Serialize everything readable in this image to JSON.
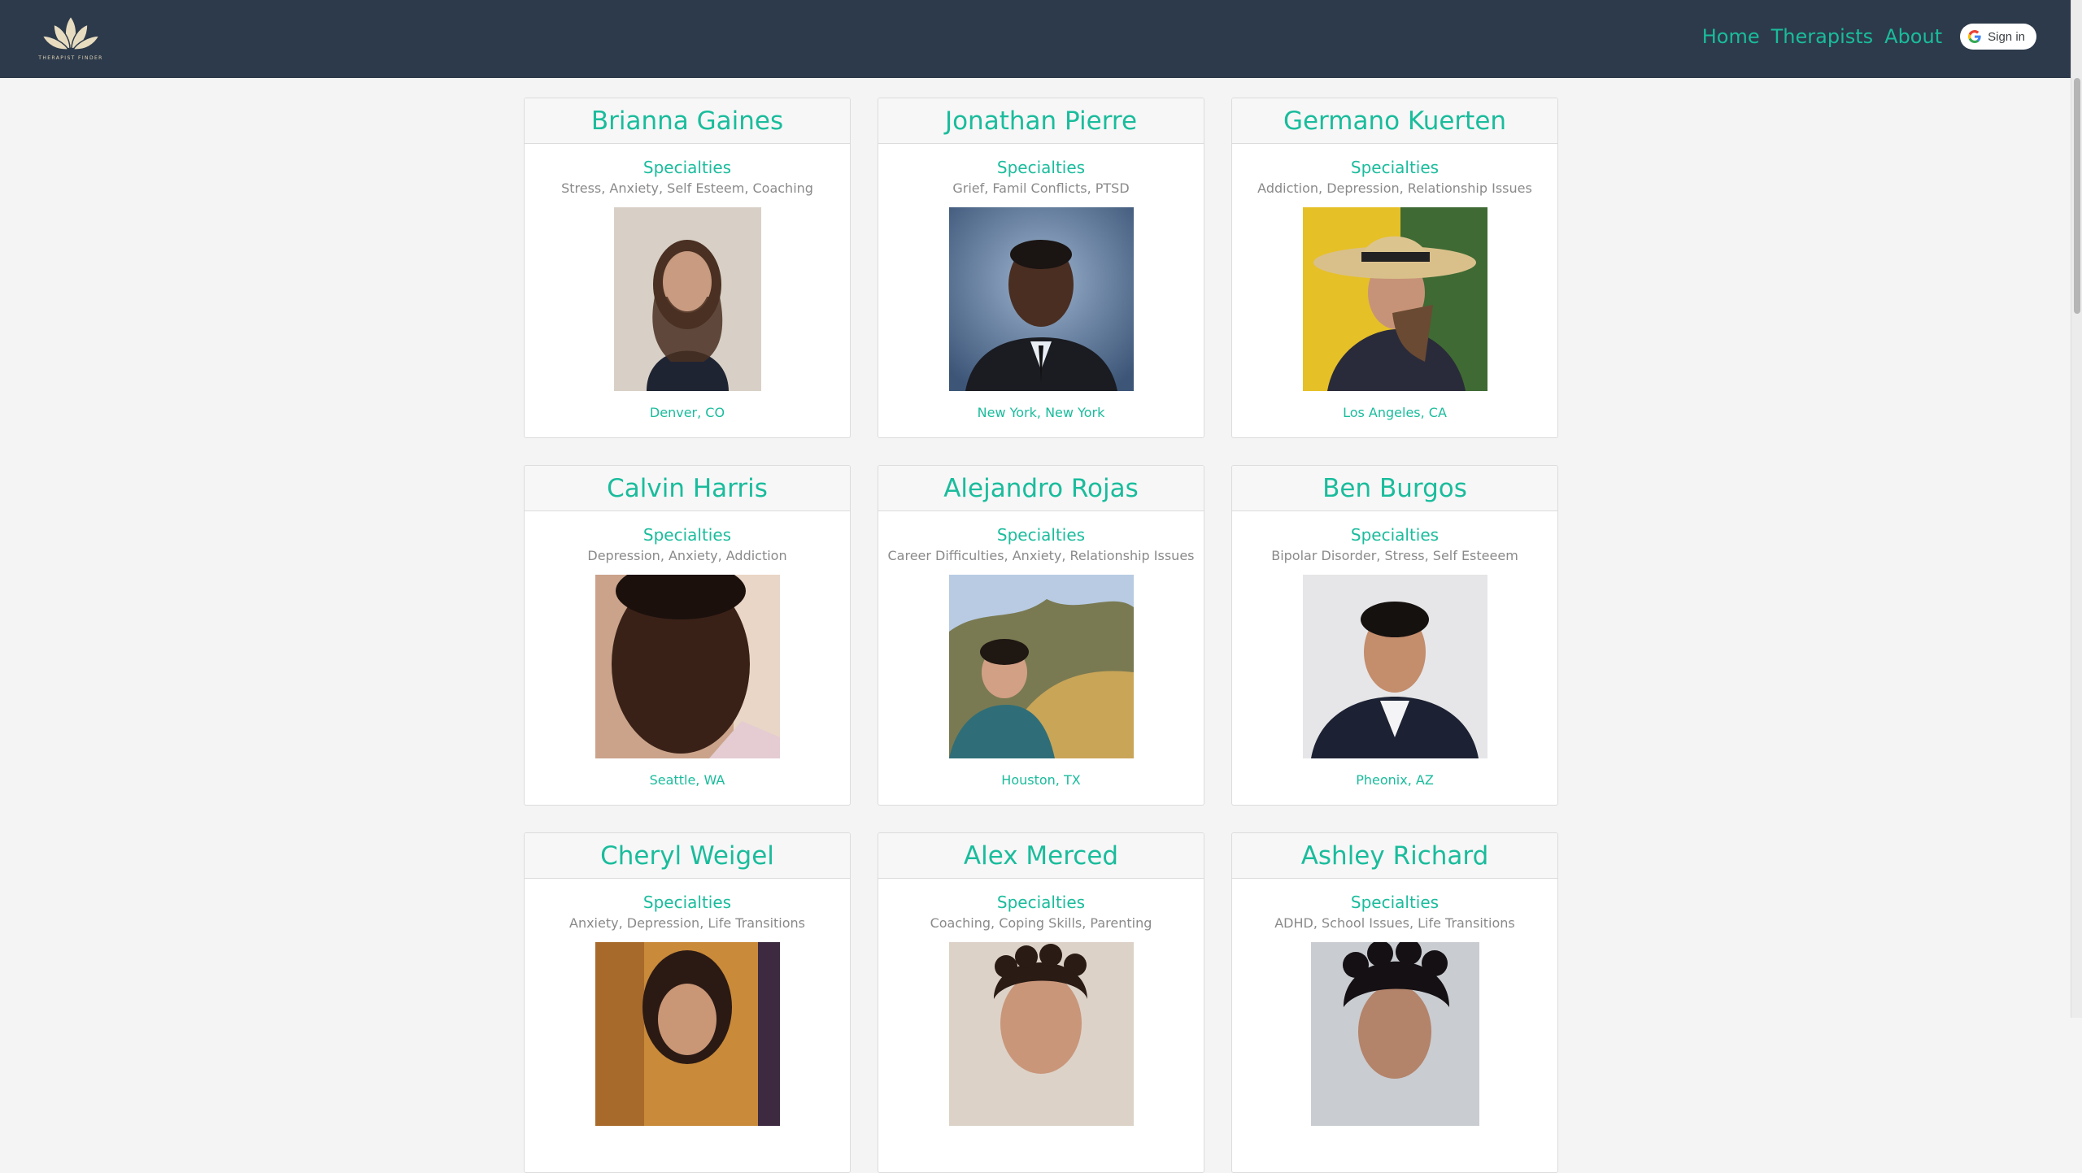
{
  "brand": {
    "logo_icon": "lotus-icon",
    "logo_text": "THERAPIST FINDER",
    "accent_color": "#1abc9c",
    "nav_bg": "#2d3a4b"
  },
  "nav": {
    "links": [
      "Home",
      "Therapists",
      "About"
    ],
    "signin_label": "Sign in"
  },
  "therapists": [
    {
      "name": "Brianna Gaines",
      "specialties_label": "Specialties",
      "specialties": "Stress, Anxiety, Self Esteem, Coaching",
      "location": "Denver, CO"
    },
    {
      "name": "Jonathan Pierre",
      "specialties_label": "Specialties",
      "specialties": "Grief, Famil Conflicts, PTSD",
      "location": "New York, New York"
    },
    {
      "name": "Germano Kuerten",
      "specialties_label": "Specialties",
      "specialties": "Addiction, Depression, Relationship Issues",
      "location": "Los Angeles, CA"
    },
    {
      "name": "Calvin Harris",
      "specialties_label": "Specialties",
      "specialties": "Depression, Anxiety, Addiction",
      "location": "Seattle, WA"
    },
    {
      "name": "Alejandro Rojas",
      "specialties_label": "Specialties",
      "specialties": "Career Difficulties, Anxiety, Relationship Issues",
      "location": "Houston, TX"
    },
    {
      "name": "Ben Burgos",
      "specialties_label": "Specialties",
      "specialties": "Bipolar Disorder, Stress, Self Esteeem",
      "location": "Pheonix, AZ"
    },
    {
      "name": "Cheryl Weigel",
      "specialties_label": "Specialties",
      "specialties": "Anxiety, Depression, Life Transitions",
      "location": ""
    },
    {
      "name": "Alex Merced",
      "specialties_label": "Specialties",
      "specialties": "Coaching, Coping Skills, Parenting",
      "location": ""
    },
    {
      "name": "Ashley Richard",
      "specialties_label": "Specialties",
      "specialties": "ADHD, School Issues, Life Transitions",
      "location": ""
    }
  ]
}
